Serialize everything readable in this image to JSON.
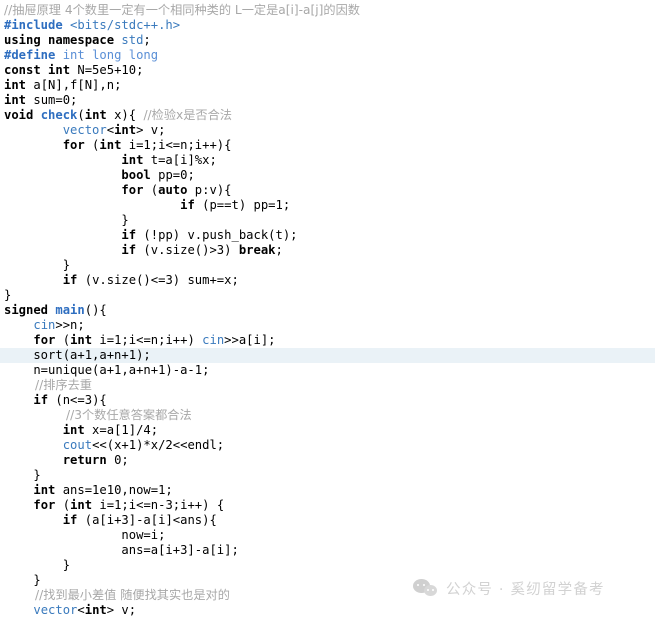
{
  "editor": {
    "background_color": "#ffffff",
    "highlight_color": "#eaf2f7",
    "comment_color": "#a8a8a8",
    "keyword_color": "#000000",
    "preprocessor_color": "#2e6ec0",
    "library_color": "#3a7abd",
    "highlighted_line_index": 23
  },
  "code": {
    "lines": [
      {
        "id": "line-1",
        "text": "//抽屉原理 4个数里一定有一个相同种类的 L一定是a[i]-a[j]的因数"
      },
      {
        "id": "line-2",
        "text": "#include <bits/stdc++.h>"
      },
      {
        "id": "line-3",
        "text": "using namespace std;"
      },
      {
        "id": "line-4",
        "text": "#define int long long"
      },
      {
        "id": "line-5",
        "text": "const int N=5e5+10;"
      },
      {
        "id": "line-6",
        "text": "int a[N],f[N],n;"
      },
      {
        "id": "line-7",
        "text": "int sum=0;"
      },
      {
        "id": "line-8",
        "text": "void check(int x){ //检验x是否合法"
      },
      {
        "id": "line-9",
        "text": "        vector<int> v;"
      },
      {
        "id": "line-10",
        "text": "        for (int i=1;i<=n;i++){"
      },
      {
        "id": "line-11",
        "text": "                int t=a[i]%x;"
      },
      {
        "id": "line-12",
        "text": "                bool pp=0;"
      },
      {
        "id": "line-13",
        "text": "                for (auto p:v){"
      },
      {
        "id": "line-14",
        "text": "                        if (p==t) pp=1;"
      },
      {
        "id": "line-15",
        "text": "                }"
      },
      {
        "id": "line-16",
        "text": "                if (!pp) v.push_back(t);"
      },
      {
        "id": "line-17",
        "text": "                if (v.size()>3) break;"
      },
      {
        "id": "line-18",
        "text": "        }"
      },
      {
        "id": "line-19",
        "text": "        if (v.size()<=3) sum+=x;"
      },
      {
        "id": "line-20",
        "text": "}"
      },
      {
        "id": "line-21",
        "text": "signed main(){"
      },
      {
        "id": "line-22",
        "text": "    cin>>n;"
      },
      {
        "id": "line-23",
        "text": "    for (int i=1;i<=n;i++) cin>>a[i];"
      },
      {
        "id": "line-24",
        "text": "    sort(a+1,a+n+1);"
      },
      {
        "id": "line-25",
        "text": "    n=unique(a+1,a+n+1)-a-1;"
      },
      {
        "id": "line-26",
        "text": "        //排序去重"
      },
      {
        "id": "line-27",
        "text": "    if (n<=3){"
      },
      {
        "id": "line-28",
        "text": "                //3个数任意答案都合法"
      },
      {
        "id": "line-29",
        "text": "        int x=a[1]/4;"
      },
      {
        "id": "line-30",
        "text": "        cout<<(x+1)*x/2<<endl;"
      },
      {
        "id": "line-31",
        "text": "        return 0;"
      },
      {
        "id": "line-32",
        "text": "    }"
      },
      {
        "id": "line-33",
        "text": "    int ans=1e10,now=1;"
      },
      {
        "id": "line-34",
        "text": "    for (int i=1;i<=n-3;i++) {"
      },
      {
        "id": "line-35",
        "text": "        if (a[i+3]-a[i]<ans){"
      },
      {
        "id": "line-36",
        "text": "                now=i;"
      },
      {
        "id": "line-37",
        "text": "                ans=a[i+3]-a[i];"
      },
      {
        "id": "line-38",
        "text": "        }"
      },
      {
        "id": "line-39",
        "text": "    }"
      },
      {
        "id": "line-40",
        "text": "        //找到最小差值 随便找其实也是对的"
      },
      {
        "id": "line-41",
        "text": "    vector<int> v;"
      }
    ]
  },
  "watermark": {
    "icon": "wechat-logo-icon",
    "text": "公众号 · 奚纫留学备考",
    "color": "#d2d2d2"
  }
}
